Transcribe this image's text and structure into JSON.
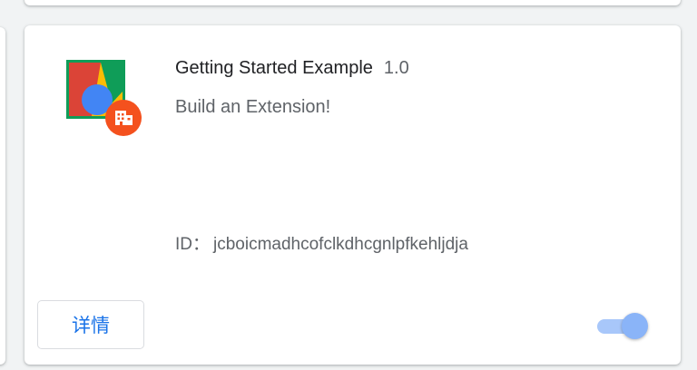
{
  "extension": {
    "name": "Getting Started Example",
    "version": "1.0",
    "description": "Build an Extension!",
    "id_label": "ID：",
    "id_value": "jcboicmadhcofclkdhcgnlpfkehljdja",
    "details_label": "详情",
    "enabled": true
  },
  "colors": {
    "accent": "#1a73e8",
    "toggle_track": "#a8c7fa",
    "toggle_knob": "#8ab4f8",
    "badge": "#f4511e"
  },
  "icons": {
    "extension_icon": "extension-logo-icon",
    "badge_icon": "building-badge-icon"
  }
}
